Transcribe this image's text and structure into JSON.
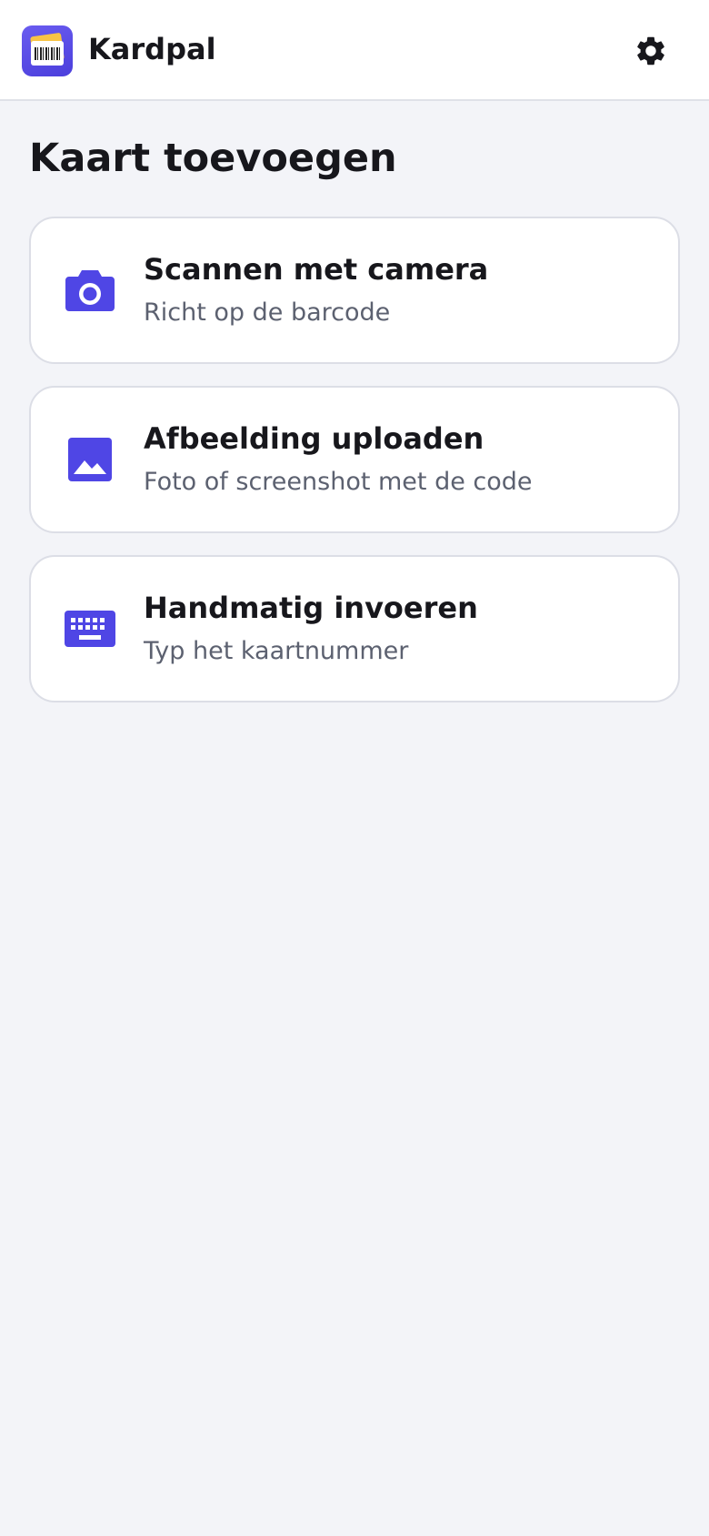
{
  "app": {
    "name": "Kardpal",
    "accent_color": "#4f46e5",
    "logo_icon": "loyalty-card-logo",
    "settings_icon": "gear-icon"
  },
  "page": {
    "title": "Kaart toevoegen"
  },
  "options": [
    {
      "icon": "camera-icon",
      "title": "Scannen met camera",
      "subtitle": "Richt op de barcode"
    },
    {
      "icon": "image-icon",
      "title": "Afbeelding uploaden",
      "subtitle": "Foto of screenshot met de code"
    },
    {
      "icon": "keyboard-icon",
      "title": "Handmatig invoeren",
      "subtitle": "Typ het kaartnummer"
    }
  ]
}
